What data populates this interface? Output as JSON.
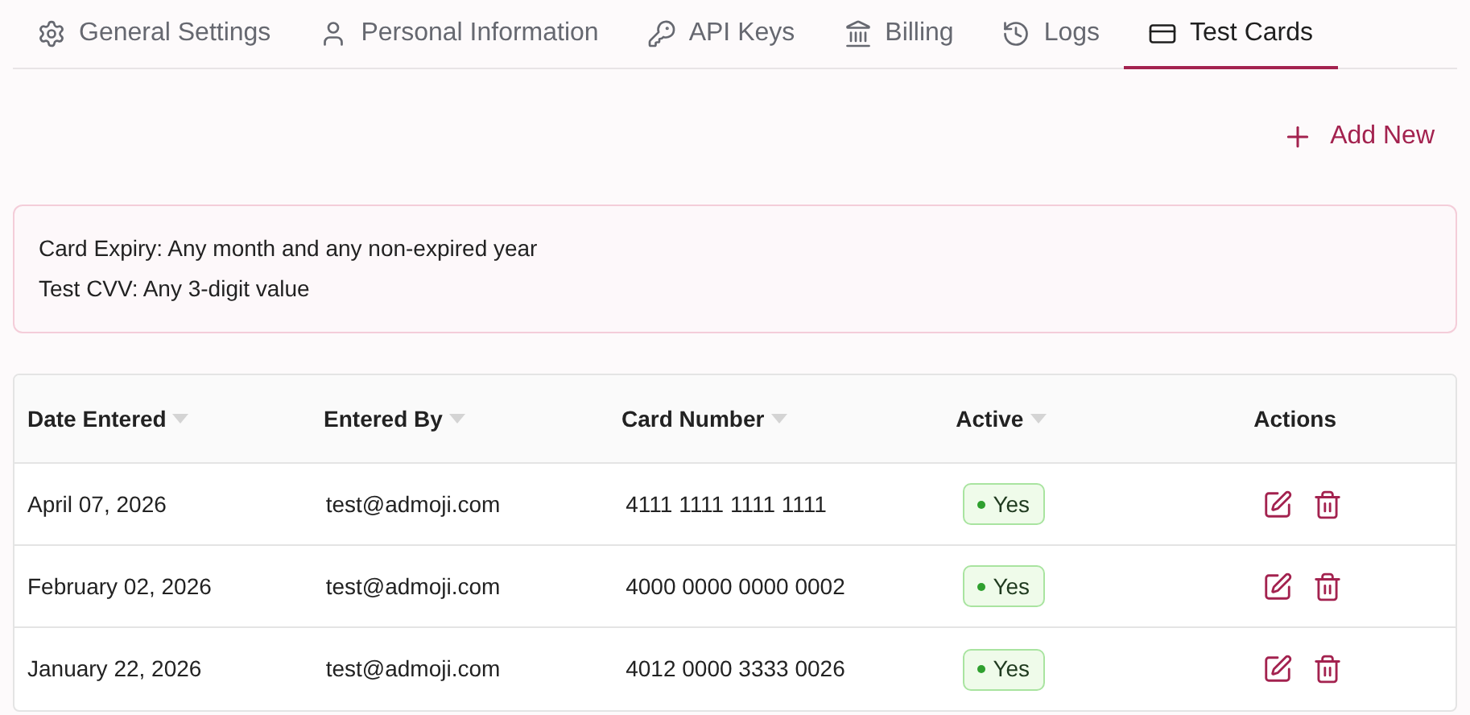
{
  "tabs": [
    {
      "label": "General Settings",
      "kind": "gear",
      "selected": false
    },
    {
      "label": "Personal Information",
      "kind": "user",
      "selected": false
    },
    {
      "label": "API Keys",
      "kind": "key",
      "selected": false
    },
    {
      "label": "Billing",
      "kind": "bank",
      "selected": false
    },
    {
      "label": "Logs",
      "kind": "history",
      "selected": false
    },
    {
      "label": "Test Cards",
      "kind": "card",
      "selected": true
    }
  ],
  "add_button": "Add New",
  "notice": [
    "Card Expiry: Any month and any non-expired year",
    "Test CVV: Any 3-digit value"
  ],
  "table": {
    "columns": [
      {
        "label": "Date Entered",
        "sortable": true
      },
      {
        "label": "Entered By",
        "sortable": true
      },
      {
        "label": "Card Number",
        "sortable": true
      },
      {
        "label": "Active",
        "sortable": true
      },
      {
        "label": "Actions",
        "sortable": false
      }
    ],
    "rows": [
      {
        "date": "April 07, 2026",
        "by": "test@admoji.com",
        "card": "4111 1111 1111 1111",
        "active": {
          "label": "Yes",
          "on": true
        }
      },
      {
        "date": "February 02, 2026",
        "by": "test@admoji.com",
        "card": "4000 0000 0000 0002",
        "active": {
          "label": "Yes",
          "on": true
        }
      },
      {
        "date": "January 22, 2026",
        "by": "test@admoji.com",
        "card": "4012 0000 3333 0026",
        "active": {
          "label": "Yes",
          "on": true
        }
      }
    ]
  }
}
